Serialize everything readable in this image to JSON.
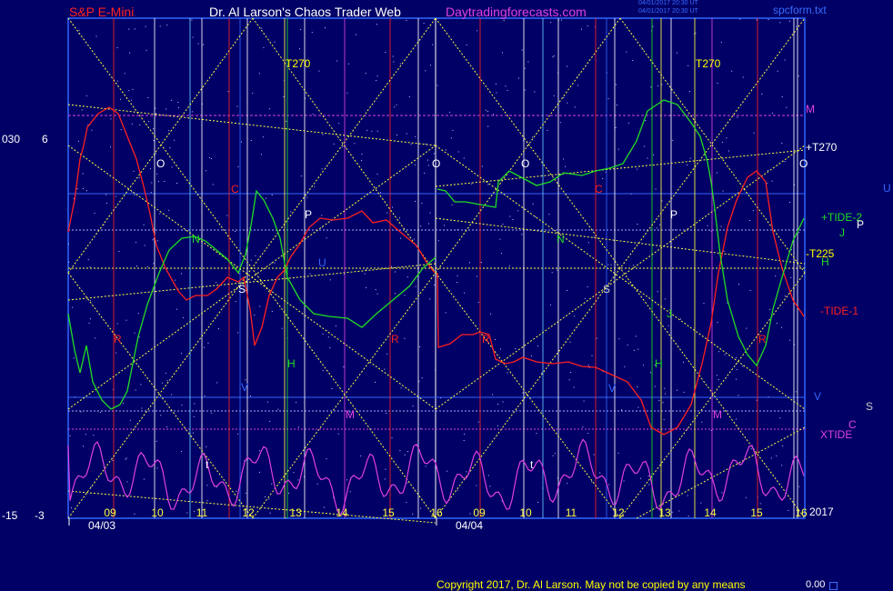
{
  "header": {
    "symbol": "S&P E-Mini",
    "site": "Dr. Al Larson's Chaos Trader Web",
    "link": "Daytradingforecasts.com",
    "stamp1": "04/01/2017 20:30 UT",
    "stamp2": "04/01/2017 20:30 UT",
    "file": "spcform.txt"
  },
  "footer": {
    "copyright": "Copyright 2017, Dr. Al Larson. May not be copied by any means",
    "value": "0.00"
  },
  "left_labels": {
    "y_top": "030",
    "y_top_b": "6",
    "y_bot": "-15",
    "y_bot_b": "-3"
  },
  "year": "2017",
  "colors": {
    "bg": "#000066",
    "frame": "#3366ff",
    "price": "#ff2020",
    "forecast": "#22dd22",
    "xtide": "#e040e0",
    "cycle": "#ffff44"
  },
  "chart_data": {
    "type": "line",
    "x_day_labels": [
      "04/03",
      "04/04"
    ],
    "hour_ticks": [
      "09",
      "10",
      "11",
      "12",
      "13",
      "14",
      "15",
      "16",
      "09",
      "10",
      "11",
      "12",
      "13",
      "14",
      "15",
      "16"
    ],
    "right_labels": [
      {
        "text": "M",
        "color": "#e040e0"
      },
      {
        "text": "+T270",
        "color": "#ffffff"
      },
      {
        "text": "O",
        "color": "#ffffff"
      },
      {
        "text": "U",
        "color": "#3366ff"
      },
      {
        "text": "+TIDE-2",
        "color": "#22dd22"
      },
      {
        "text": "P",
        "color": "#ffffff"
      },
      {
        "text": "J",
        "color": "#22dd22"
      },
      {
        "text": "-T225",
        "color": "#ffff00"
      },
      {
        "text": "H",
        "color": "#22dd22"
      },
      {
        "text": "-TIDE-1",
        "color": "#ff2020"
      },
      {
        "text": "V",
        "color": "#3366ff"
      },
      {
        "text": "S",
        "color": "#cccccc"
      },
      {
        "text": "C",
        "color": "#e040e0"
      },
      {
        "text": "XTIDE",
        "color": "#e040e0"
      }
    ],
    "plot_letters": [
      {
        "t": "O",
        "c": "#ffffff"
      },
      {
        "t": "C",
        "c": "#ff2020"
      },
      {
        "t": "N",
        "c": "#22dd22"
      },
      {
        "t": "S",
        "c": "#ffffff"
      },
      {
        "t": "P",
        "c": "#ffffff"
      },
      {
        "t": "U",
        "c": "#3366ff"
      },
      {
        "t": "R",
        "c": "#ff2020"
      },
      {
        "t": "H",
        "c": "#22dd22"
      },
      {
        "t": "V",
        "c": "#3366ff"
      },
      {
        "t": "M",
        "c": "#e040e0"
      },
      {
        "t": "R",
        "c": "#ff2020"
      },
      {
        "t": "T270",
        "c": "#ffff00"
      },
      {
        "t": "t",
        "c": "#ffffff"
      },
      {
        "t": "O",
        "c": "#ffffff"
      },
      {
        "t": "O",
        "c": "#ffffff"
      },
      {
        "t": "C",
        "c": "#ff2020"
      },
      {
        "t": "N",
        "c": "#22dd22"
      },
      {
        "t": "S",
        "c": "#cccccc"
      },
      {
        "t": "R",
        "c": "#ff2020"
      },
      {
        "t": "P",
        "c": "#ffffff"
      },
      {
        "t": "J",
        "c": "#22dd22"
      },
      {
        "t": "H",
        "c": "#22dd22"
      },
      {
        "t": "V",
        "c": "#3366ff"
      },
      {
        "t": "M",
        "c": "#e040e0"
      },
      {
        "t": "R",
        "c": "#ff2020"
      },
      {
        "t": "T270",
        "c": "#ffff00"
      },
      {
        "t": "t",
        "c": "#ffffff"
      }
    ]
  }
}
